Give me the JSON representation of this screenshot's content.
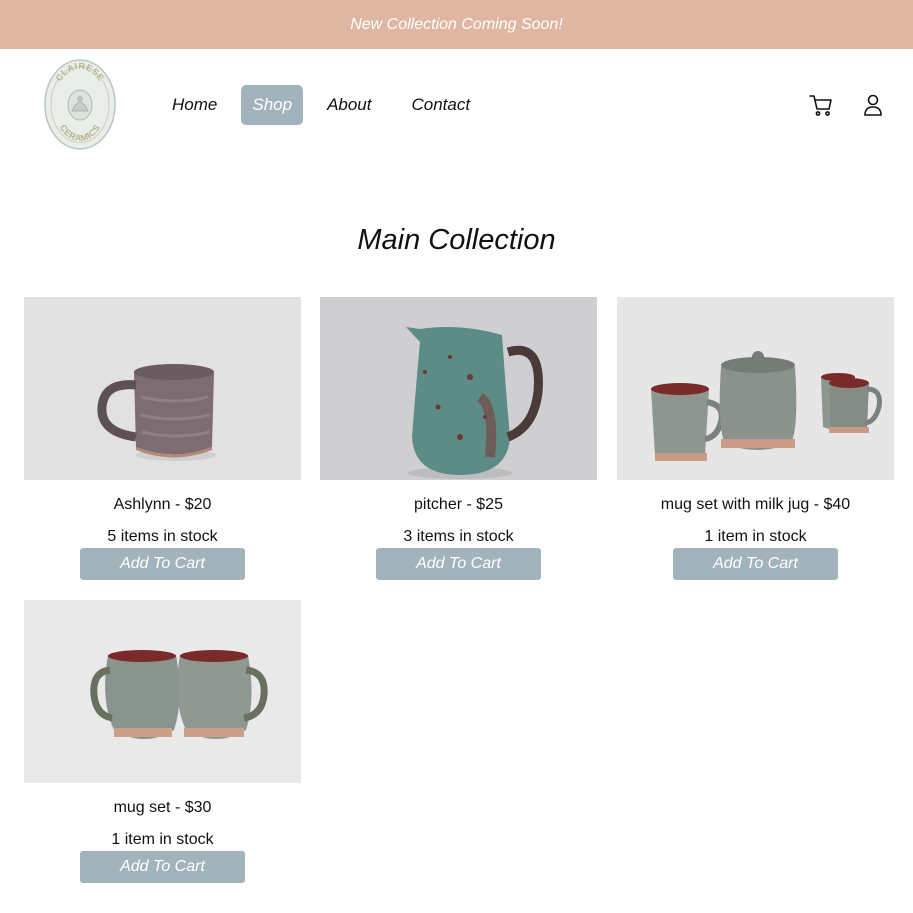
{
  "banner": {
    "text": "New Collection Coming Soon!"
  },
  "brand": {
    "logo_icon": "clairese-ceramics-logo",
    "logo_text_top": "CLAIRESE",
    "logo_text_bottom": "CERAMICS"
  },
  "nav": {
    "items": [
      {
        "label": "Home",
        "active": false
      },
      {
        "label": "Shop",
        "active": true
      },
      {
        "label": "About",
        "active": false
      },
      {
        "label": "Contact",
        "active": false
      }
    ]
  },
  "header_icons": {
    "cart": "cart-icon",
    "account": "user-icon"
  },
  "page": {
    "title": "Main Collection"
  },
  "products": [
    {
      "name": "Ashlynn - $20",
      "stock": "5 items in stock",
      "button": "Add To Cart",
      "image": "brown-grey-mug"
    },
    {
      "name": "pitcher - $25",
      "stock": "3 items in stock",
      "button": "Add To Cart",
      "image": "teal-speckled-pitcher"
    },
    {
      "name": "mug set with milk jug - $40",
      "stock": "1 item in stock",
      "button": "Add To Cart",
      "image": "mug-set-with-jug"
    },
    {
      "name": "mug set - $30",
      "stock": "1 item in stock",
      "button": "Add To Cart",
      "image": "two-grey-mugs"
    }
  ],
  "colors": {
    "banner": "#dfb6a1",
    "accent": "#a3b3bc",
    "text": "#111111"
  }
}
